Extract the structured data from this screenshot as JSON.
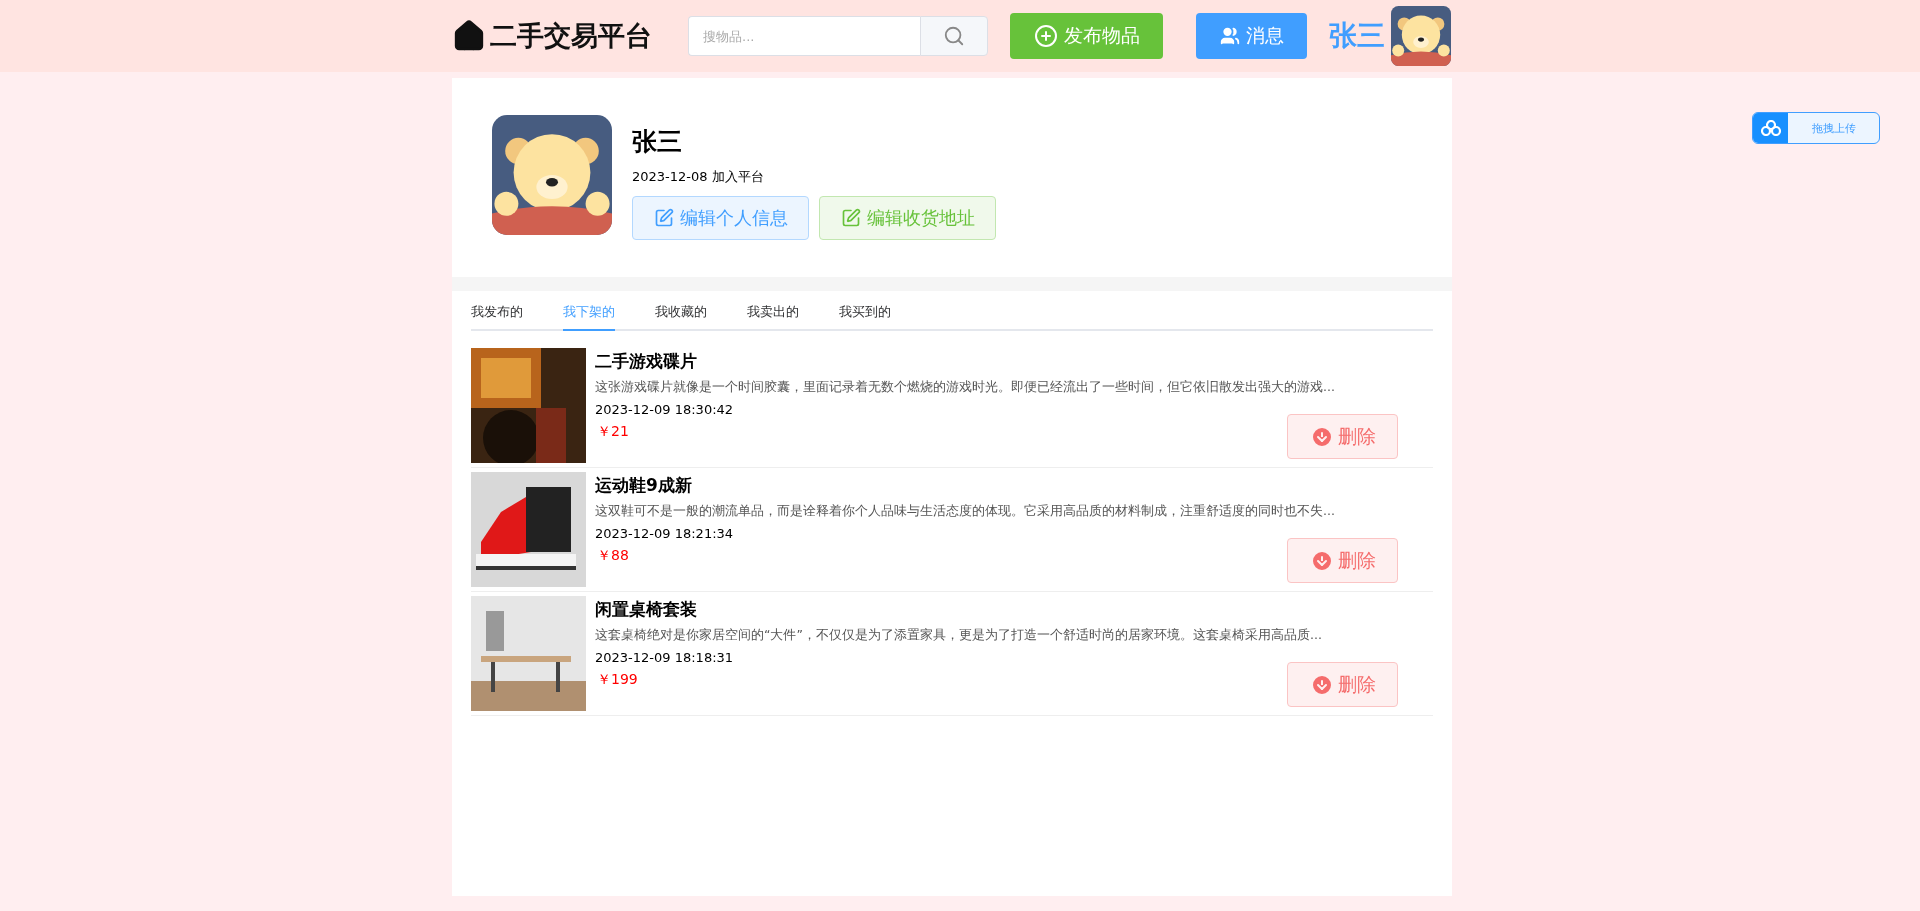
{
  "header": {
    "logo": "二手交易平台",
    "search": {
      "placeholder": "搜物品..."
    },
    "publish_button": "发布物品",
    "message_button": "消息",
    "user_name": "张三"
  },
  "upload_button": "拖拽上传",
  "profile": {
    "name": "张三",
    "joined": "2023-12-08 加入平台",
    "edit_info_button": "编辑个人信息",
    "edit_address_button": "编辑收货地址"
  },
  "tabs": [
    {
      "label": "我发布的",
      "selected": false
    },
    {
      "label": "我下架的",
      "selected": true
    },
    {
      "label": "我收藏的",
      "selected": false
    },
    {
      "label": "我卖出的",
      "selected": false
    },
    {
      "label": "我买到的",
      "selected": false
    }
  ],
  "items": [
    {
      "title": "二手游戏碟片",
      "description": "这张游戏碟片就像是一个时间胶囊，里面记录着无数个燃烧的游戏时光。即便已经流出了一些时间，但它依旧散发出强大的游戏...",
      "time": "2023-12-09 18:30:42",
      "price": "￥21",
      "delete_button": "删除"
    },
    {
      "title": "运动鞋9成新",
      "description": "这双鞋可不是一般的潮流单品，而是诠释着你个人品味与生活态度的体现。它采用高品质的材料制成，注重舒适度的同时也不失...",
      "time": "2023-12-09 18:21:34",
      "price": "￥88",
      "delete_button": "删除"
    },
    {
      "title": "闲置桌椅套装",
      "description": "这套桌椅绝对是你家居空间的“大件”，不仅仅是为了添置家具，更是为了打造一个舒适时尚的居家环境。这套桌椅采用高品质...",
      "time": "2023-12-09 18:18:31",
      "price": "￥199",
      "delete_button": "删除"
    }
  ]
}
